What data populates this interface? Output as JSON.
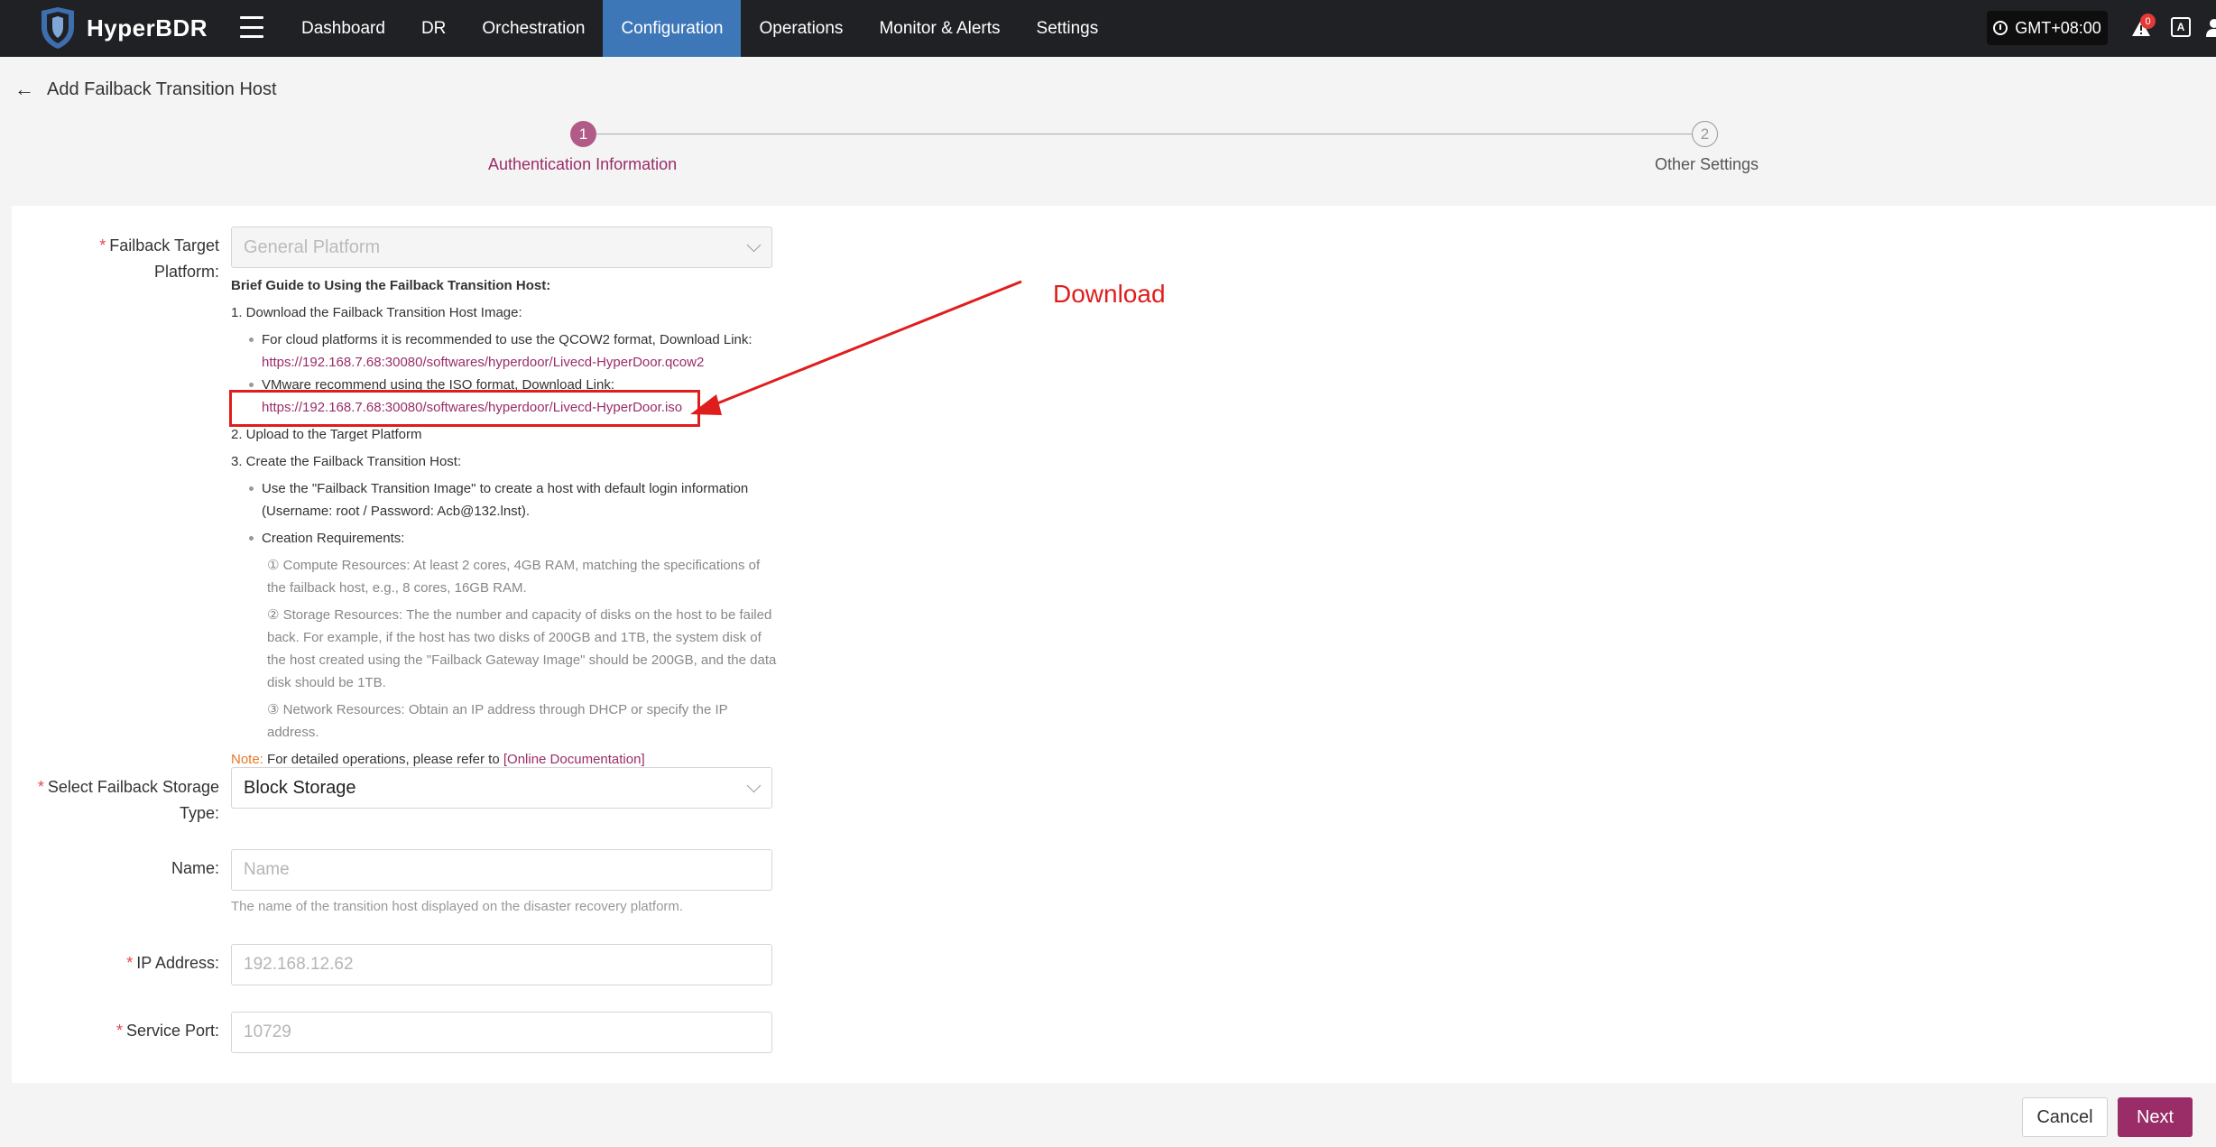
{
  "app": {
    "name": "HyperBDR"
  },
  "nav": {
    "items": [
      "Dashboard",
      "DR",
      "Orchestration",
      "Configuration",
      "Operations",
      "Monitor & Alerts",
      "Settings"
    ],
    "active": "Configuration"
  },
  "header": {
    "timezone": "GMT+08:00",
    "alert_count": "0",
    "font_icon": "A"
  },
  "page": {
    "title": "Add Failback Transition Host"
  },
  "steps": [
    {
      "number": "1",
      "label": "Authentication Information"
    },
    {
      "number": "2",
      "label": "Other Settings"
    }
  ],
  "form": {
    "platform": {
      "label": "Failback Target Platform:",
      "value": "General Platform"
    },
    "storage": {
      "label": "Select Failback Storage Type:",
      "value": "Block Storage"
    },
    "name": {
      "label": "Name:",
      "placeholder": "Name",
      "helper": "The name of the transition host displayed on the disaster recovery platform."
    },
    "ip": {
      "label": "IP Address:",
      "placeholder": "192.168.12.62"
    },
    "port": {
      "label": "Service Port:",
      "placeholder": "10729"
    }
  },
  "guide": {
    "title": "Brief Guide to Using the Failback Transition Host:",
    "step1": "1. Download the Failback Transition Host Image:",
    "cloud_text": "For cloud platforms it is recommended to use the QCOW2 format, Download Link:",
    "cloud_link": "https://192.168.7.68:30080/softwares/hyperdoor/Livecd-HyperDoor.qcow2",
    "vmware_text": "VMware recommend using the ISO format, Download Link:",
    "vmware_link": "https://192.168.7.68:30080/softwares/hyperdoor/Livecd-HyperDoor.iso",
    "step2": "2. Upload to the Target Platform",
    "step3": "3. Create the Failback Transition Host:",
    "use_text": "Use the \"Failback Transition Image\" to create a host with default login information",
    "use_text2": "(Username: root / Password: Acb@132.lnst).",
    "req_title": "Creation Requirements:",
    "req1": "① Compute Resources: At least 2 cores, 4GB RAM, matching the specifications of the failback host, e.g., 8 cores, 16GB RAM.",
    "req2": "② Storage Resources: The the number and capacity of disks on the host to be failed back. For example, if the host has two disks of 200GB and 1TB, the system disk of the host created using the \"Failback Gateway Image\" should be 200GB, and the data disk should be 1TB.",
    "req3": "③ Network Resources: Obtain an IP address through DHCP or specify the IP address.",
    "note_label": "Note:",
    "note_text": " For detailed operations, please refer to ",
    "doc_link": "[Online Documentation]"
  },
  "annotation": {
    "text": "Download",
    "color": "#e01d1d"
  },
  "buttons": {
    "cancel": "Cancel",
    "next": "Next"
  },
  "colors": {
    "primary": "#9a2d68",
    "topbar": "#202124",
    "nav_active": "#3d77b8"
  }
}
